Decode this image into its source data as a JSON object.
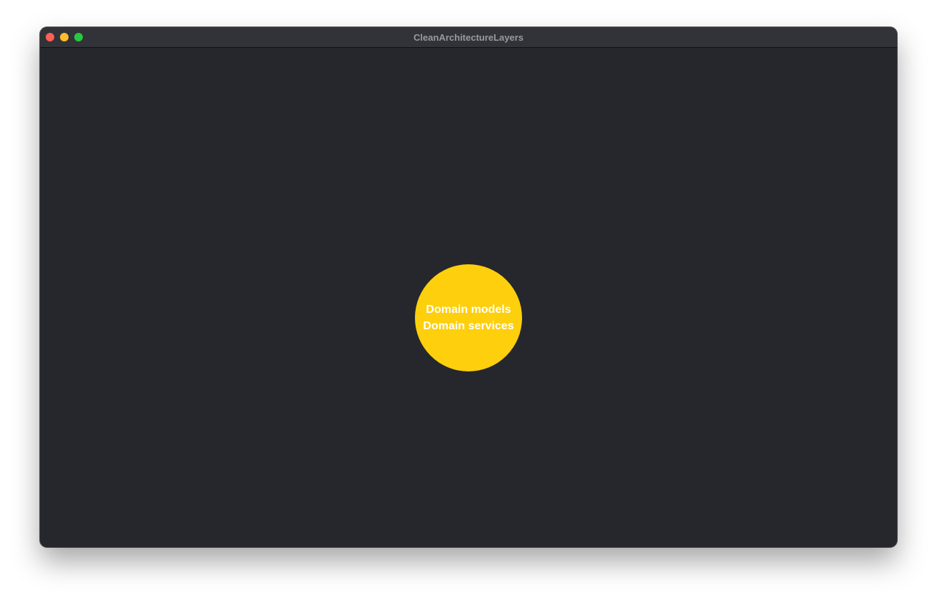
{
  "window": {
    "title": "CleanArchitectureLayers",
    "traffic_lights": {
      "close": "#fe5f57",
      "minimize": "#febc2e",
      "zoom": "#28c840"
    }
  },
  "diagram": {
    "layer": {
      "color": "#fecf0c",
      "lines": [
        "Domain models",
        "Domain services"
      ]
    }
  }
}
